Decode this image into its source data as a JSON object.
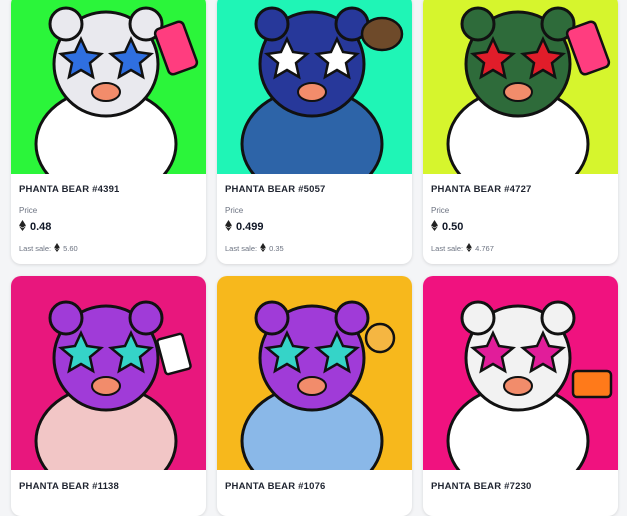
{
  "price_label": "Price",
  "last_sale_label": "Last sale:",
  "cards": [
    {
      "name": "PHANTA BEAR #4391",
      "price": "0.48",
      "last_sale": "5.60",
      "bg": "#2bf53a",
      "jacket": "#ffffff",
      "face": "#e9e9ee",
      "accent": "#ff3d7f",
      "glasses": "#2f6fe0"
    },
    {
      "name": "PHANTA BEAR #5057",
      "price": "0.499",
      "last_sale": "0.35",
      "bg": "#1ff5b6",
      "jacket": "#2d64a8",
      "face": "#27389a",
      "accent": "#6e4a2a",
      "glasses": "#ffffff"
    },
    {
      "name": "PHANTA BEAR #4727",
      "price": "0.50",
      "last_sale": "4.767",
      "bg": "#d6f52d",
      "jacket": "#ffffff",
      "face": "#2e6b3a",
      "accent": "#ff3d7f",
      "glasses": "#e11d2a"
    },
    {
      "name": "PHANTA BEAR #1138",
      "price": "",
      "last_sale": "",
      "bg": "#e8177d",
      "jacket": "#f2c6c6",
      "face": "#a03bd8",
      "accent": "#ffffff",
      "glasses": "#35d4c8"
    },
    {
      "name": "PHANTA BEAR #1076",
      "price": "",
      "last_sale": "",
      "bg": "#f7b81c",
      "jacket": "#8ab8e8",
      "face": "#a03bd8",
      "accent": "#f5b642",
      "glasses": "#35d4c8"
    },
    {
      "name": "PHANTA BEAR #7230",
      "price": "",
      "last_sale": "",
      "bg": "#f0127f",
      "jacket": "#ffffff",
      "face": "#f2f2f2",
      "accent": "#ff7a1a",
      "glasses": "#e11d9a"
    }
  ]
}
